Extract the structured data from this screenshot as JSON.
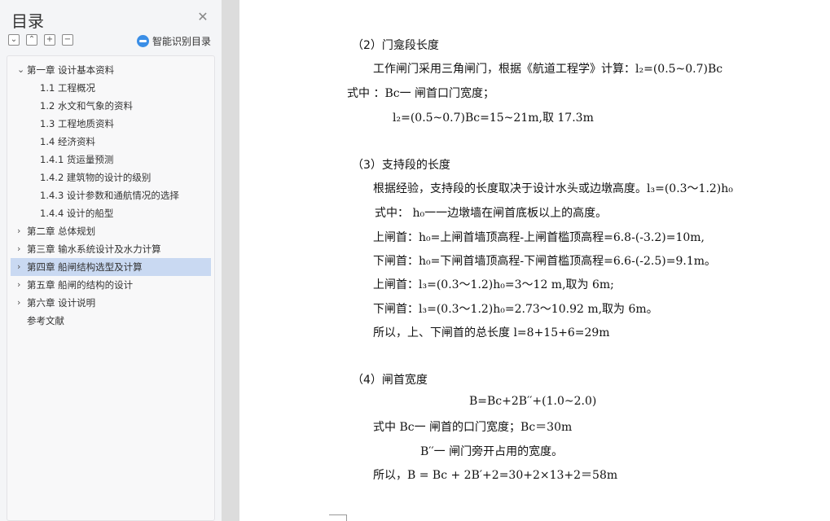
{
  "toc": {
    "title": "目录",
    "close_icon": "close-icon",
    "tools": [
      "collapse-all-icon",
      "expand-all-icon",
      "add-heading-icon",
      "remove-heading-icon"
    ],
    "smart_label": "智能识别目录",
    "items": [
      {
        "label": "第一章  设计基本资料",
        "chevron": "⌄"
      },
      {
        "label": "1.1  工程概况"
      },
      {
        "label": "1.2  水文和气象的资料"
      },
      {
        "label": "1.3  工程地质资料"
      },
      {
        "label": "1.4  经济资料"
      },
      {
        "label": "1.4.1  货运量预测"
      },
      {
        "label": "1.4.2  建筑物的设计的级别"
      },
      {
        "label": "1.4.3  设计参数和通航情况的选择"
      },
      {
        "label": "1.4.4  设计的船型"
      },
      {
        "label": "第二章  总体规划",
        "chevron": "›"
      },
      {
        "label": "第三章  输水系统设计及水力计算",
        "chevron": "›"
      },
      {
        "label": "第四章  船闸结构选型及计算",
        "chevron": "›"
      },
      {
        "label": "第五章  船闸的结构的设计",
        "chevron": "›"
      },
      {
        "label": "第六章  设计说明",
        "chevron": "›"
      },
      {
        "label": "参考文献"
      }
    ]
  },
  "document": {
    "lines": [
      "（2）门龛段长度",
      "工作闸门采用三角闸门，根据《航道工程学》计算：l₂=(0.5~0.7)Bc",
      "式中 ：Bc一 闸首口门宽度；",
      "l₂=(0.5~0.7)Bc=15~21m,取 17.3m",
      "（3）支持段的长度",
      "根据经验，支持段的长度取决于设计水头或边墩高度。l₃=(0.3～1.2)h₀",
      "式中： h₀一一边墩墙在闸首底板以上的高度。",
      "上闸首：h₀=上闸首墙顶高程-上闸首槛顶高程=6.8-(-3.2)=10m,",
      "下闸首：h₀=下闸首墙顶高程-下闸首槛顶高程=6.6-(-2.5)=9.1m。",
      "上闸首：l₃=(0.3～1.2)h₀=3～12 m,取为 6m;",
      "下闸首：l₃=(0.3～1.2)h₀=2.73～10.92 m,取为 6m。",
      "所以，上、下闸首的总长度 l=8+15+6=29m",
      "（4）闸首宽度",
      "B=Bc+2B′′+(1.0~2.0)",
      "式中    Bc一 闸首的口门宽度；Bc＝30m",
      "B′′一 闸门旁开占用的宽度。",
      "所以，B = Bc + 2B′+2=30+2×13+2＝58m"
    ]
  }
}
